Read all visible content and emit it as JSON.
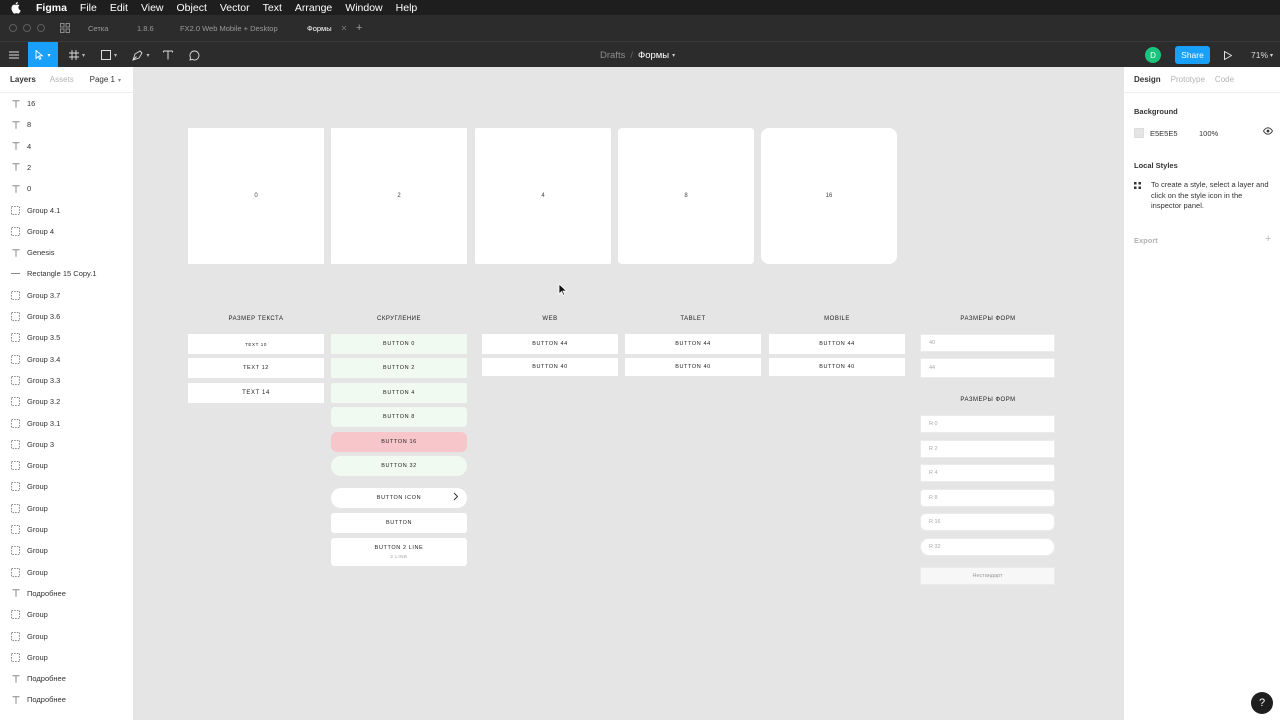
{
  "menubar": {
    "app": "Figma",
    "items": [
      "File",
      "Edit",
      "View",
      "Object",
      "Vector",
      "Text",
      "Arrange",
      "Window",
      "Help"
    ]
  },
  "tabs": [
    {
      "label": "Сетка"
    },
    {
      "label": "1.8.6"
    },
    {
      "label": "FX2.0 Web Mobile + Desktop"
    },
    {
      "label": "Формы",
      "active": true
    }
  ],
  "toolbar": {
    "breadcrumb_root": "Drafts",
    "breadcrumb_current": "Формы",
    "avatar_initial": "D",
    "share_label": "Share",
    "zoom": "71%"
  },
  "left_panel": {
    "tabs": {
      "layers": "Layers",
      "assets": "Assets",
      "page": "Page 1"
    },
    "layers": [
      {
        "icon": "text",
        "name": "16"
      },
      {
        "icon": "text",
        "name": "8"
      },
      {
        "icon": "text",
        "name": "4"
      },
      {
        "icon": "text",
        "name": "2"
      },
      {
        "icon": "text",
        "name": "0"
      },
      {
        "icon": "group",
        "name": "Group 4.1"
      },
      {
        "icon": "group",
        "name": "Group 4"
      },
      {
        "icon": "text",
        "name": "Genesis"
      },
      {
        "icon": "line",
        "name": "Rectangle 15 Copy.1"
      },
      {
        "icon": "group",
        "name": "Group 3.7"
      },
      {
        "icon": "group",
        "name": "Group 3.6"
      },
      {
        "icon": "group",
        "name": "Group 3.5"
      },
      {
        "icon": "group",
        "name": "Group 3.4"
      },
      {
        "icon": "group",
        "name": "Group 3.3"
      },
      {
        "icon": "group",
        "name": "Group 3.2"
      },
      {
        "icon": "group",
        "name": "Group 3.1"
      },
      {
        "icon": "group",
        "name": "Group 3"
      },
      {
        "icon": "group",
        "name": "Group"
      },
      {
        "icon": "group",
        "name": "Group"
      },
      {
        "icon": "group",
        "name": "Group"
      },
      {
        "icon": "group",
        "name": "Group"
      },
      {
        "icon": "group",
        "name": "Group"
      },
      {
        "icon": "group",
        "name": "Group"
      },
      {
        "icon": "text",
        "name": "Подробнее"
      },
      {
        "icon": "group",
        "name": "Group"
      },
      {
        "icon": "group",
        "name": "Group"
      },
      {
        "icon": "group",
        "name": "Group"
      },
      {
        "icon": "text",
        "name": "Подробнее"
      },
      {
        "icon": "text",
        "name": "Подробнее"
      }
    ]
  },
  "right_panel": {
    "tabs": {
      "design": "Design",
      "prototype": "Prototype",
      "code": "Code"
    },
    "background_title": "Background",
    "background_hex": "E5E5E5",
    "background_opacity": "100%",
    "local_styles_title": "Local Styles",
    "local_styles_help": "To create a style, select a layer and click on the style icon in the inspector panel.",
    "export_title": "Export"
  },
  "canvas": {
    "radius_frames": [
      "0",
      "2",
      "4",
      "8",
      "16"
    ],
    "col_text": {
      "title": "РАЗМЕР ТЕКСТА",
      "items": [
        "TEXT 10",
        "TEXT 12",
        "TEXT 14"
      ]
    },
    "col_round": {
      "title": "СКРУГЛЕНИЕ",
      "items": [
        "BUTTON 0",
        "BUTTON 2",
        "BUTTON 4",
        "BUTTON 8",
        "BUTTON 16",
        "BUTTON 32"
      ],
      "icon_button": "BUTTON ICON",
      "plain_button": "BUTTON",
      "two_line_button": "BUTTON 2 LINE",
      "two_line_sub": "2 LINE"
    },
    "col_web": {
      "title": "WEB",
      "items": [
        "BUTTON 44",
        "BUTTON 40"
      ]
    },
    "col_tablet": {
      "title": "TABLET",
      "items": [
        "BUTTON 44",
        "BUTTON 40"
      ]
    },
    "col_mobile": {
      "title": "MOBILE",
      "items": [
        "BUTTON 44",
        "BUTTON 40"
      ]
    },
    "col_forms": {
      "title": "РАЗМЕРЫ ФОРМ",
      "items": [
        "40",
        "44"
      ],
      "title2": "РАЗМЕРЫ ФОРМ",
      "items2": [
        "R 0",
        "R 2",
        "R 4",
        "R 8",
        "R 16",
        "R 32"
      ],
      "disabled": "Нестандарт"
    }
  },
  "colors": {
    "accent": "#18a0fb",
    "canvas": "#e5e5e5",
    "avatar": "#1bc47d",
    "highlight_red": "#f7c6cb",
    "highlight_green": "#f0faf0"
  }
}
